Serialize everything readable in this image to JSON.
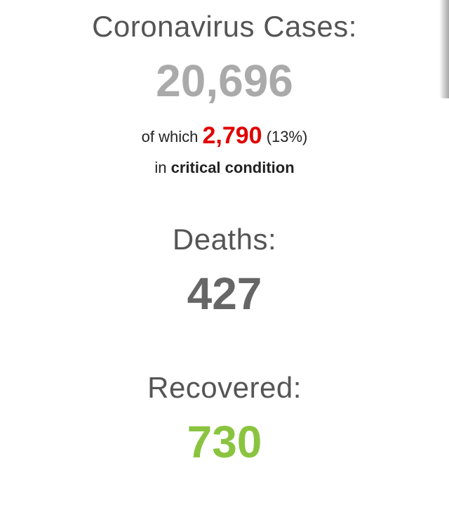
{
  "cases": {
    "label": "Coronavirus Cases:",
    "value": "20,696"
  },
  "critical": {
    "prefix": "of which",
    "value": "2,790",
    "percent": "(13%)",
    "line2_prefix": "in",
    "line2_bold": "critical condition"
  },
  "deaths": {
    "label": "Deaths:",
    "value": "427"
  },
  "recovered": {
    "label": "Recovered:",
    "value": "730"
  },
  "colors": {
    "cases_number": "#aaaaaa",
    "critical_number": "#e00000",
    "deaths_number": "#666666",
    "recovered_number": "#8ac43f",
    "label_text": "#555555"
  }
}
